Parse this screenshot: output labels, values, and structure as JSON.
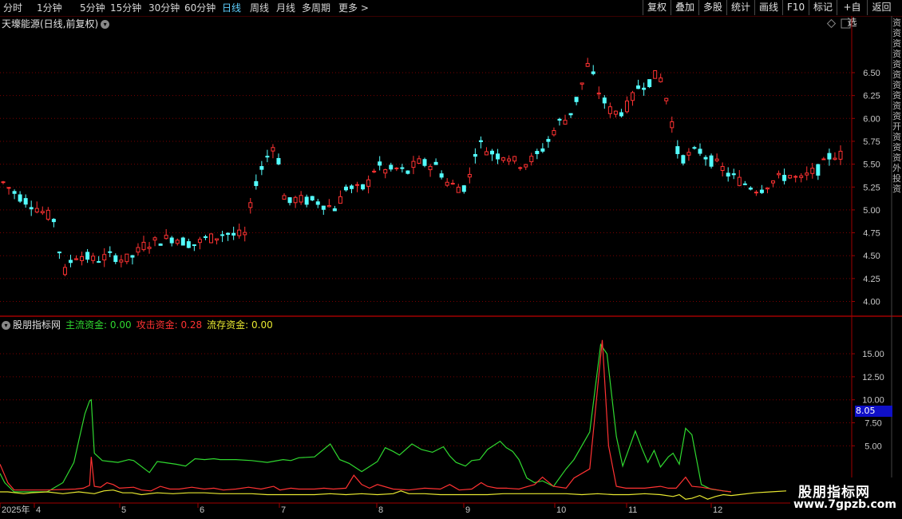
{
  "toolbar": {
    "periods": [
      "分时",
      "1分钟",
      "5分钟",
      "15分钟",
      "30分钟",
      "60分钟",
      "日线",
      "周线",
      "月线",
      "多周期",
      "更多"
    ],
    "active": "日线",
    "right": [
      "复权",
      "叠加",
      "多股",
      "统计",
      "画线",
      "F10",
      "标记",
      "+自选",
      "返回"
    ]
  },
  "main_title": "天壕能源(日线,前复权)",
  "indicator": {
    "name": "股朋指标网",
    "s1_label": "主流资金: 0.00",
    "s2_label": "攻击资金: 0.28",
    "s3_label": "流存资金: 0.00",
    "highlight_value": "8.05"
  },
  "x_labels": [
    "2025年",
    "4",
    "5",
    "6",
    "7",
    "8",
    "9",
    "10",
    "11",
    "12"
  ],
  "right_vertical_text": "资资资资资资资资资资开资资资外投资",
  "watermark": {
    "line1": "股朋指标网",
    "line2": "www.7gpzb.com"
  },
  "colors": {
    "up": "#ff3232",
    "down": "#54ffff",
    "green": "#2fd82f",
    "red": "#ff3232",
    "yellow": "#e8e830",
    "grid": "#7a0000",
    "axis": "#a00000"
  },
  "chart_data": [
    {
      "type": "candlestick",
      "title": "天壕能源(日线,前复权)",
      "y_ticks": [
        4.0,
        4.25,
        4.5,
        4.75,
        5.0,
        5.25,
        5.5,
        5.75,
        6.0,
        6.25,
        6.5
      ],
      "ylim": [
        3.9,
        6.8
      ],
      "close_path": [
        5.3,
        5.2,
        5.12,
        5.05,
        4.97,
        4.9,
        4.3,
        4.5,
        4.5,
        4.45,
        4.48,
        4.5,
        4.45,
        4.5,
        4.62,
        4.65,
        4.68,
        4.7,
        4.65,
        4.62,
        4.68,
        4.7,
        4.75,
        4.72,
        4.73,
        5.3,
        5.55,
        5.75,
        5.05,
        5.12,
        5.1,
        5.1,
        5.05,
        5.02,
        5.25,
        5.22,
        5.25,
        5.5,
        5.42,
        5.45,
        5.4,
        5.52,
        5.5,
        5.48,
        5.3,
        5.25,
        5.25,
        5.75,
        5.65,
        5.6,
        5.6,
        5.5,
        5.52,
        5.6,
        5.75,
        5.95,
        6.0,
        6.25,
        6.6,
        6.3,
        6.1,
        6.05,
        6.15,
        6.35,
        6.4,
        6.5,
        6.12,
        5.55,
        5.6,
        5.65,
        5.55,
        5.48,
        5.38,
        5.32,
        5.26,
        5.22,
        5.3,
        5.35,
        5.38,
        5.32,
        5.4,
        5.45,
        5.6,
        5.6
      ],
      "candles_drawn": 150
    },
    {
      "type": "line",
      "title": "股朋指标网",
      "y_ticks": [
        5.0,
        7.5,
        10.0,
        12.5,
        15.0
      ],
      "series": [
        {
          "name": "主流资金",
          "color": "green",
          "points": [
            [
              0,
              2
            ],
            [
              3,
              1
            ],
            [
              9,
              0
            ],
            [
              30,
              0
            ],
            [
              40,
              1
            ],
            [
              47,
              3.2
            ],
            [
              50,
              5.5
            ],
            [
              54,
              8.5
            ],
            [
              57,
              9.9
            ],
            [
              58,
              10
            ],
            [
              60,
              4.2
            ],
            [
              65,
              3.4
            ],
            [
              70,
              3.3
            ],
            [
              75,
              3.2
            ],
            [
              82,
              3.5
            ],
            [
              85,
              3.4
            ],
            [
              95,
              2.1
            ],
            [
              100,
              3.3
            ],
            [
              104,
              3.2
            ],
            [
              112,
              3
            ],
            [
              118,
              2.8
            ],
            [
              124,
              3.6
            ],
            [
              130,
              3.5
            ],
            [
              136,
              3.6
            ],
            [
              140,
              3.5
            ],
            [
              144,
              3.5
            ],
            [
              150,
              3.5
            ],
            [
              160,
              3.4
            ],
            [
              170,
              3.2
            ],
            [
              180,
              3.5
            ],
            [
              185,
              3.4
            ],
            [
              190,
              3.7
            ],
            [
              200,
              3.8
            ],
            [
              205,
              4.5
            ],
            [
              210,
              5.2
            ],
            [
              216,
              3.5
            ],
            [
              222,
              3.1
            ],
            [
              230,
              2.2
            ],
            [
              240,
              3.3
            ],
            [
              245,
              4.8
            ],
            [
              250,
              4.4
            ],
            [
              254,
              4
            ],
            [
              262,
              5.2
            ],
            [
              268,
              4.6
            ],
            [
              275,
              4.3
            ],
            [
              282,
              4.9
            ],
            [
              286,
              3.9
            ],
            [
              290,
              3.2
            ],
            [
              296,
              2.8
            ],
            [
              300,
              3.4
            ],
            [
              305,
              3.5
            ],
            [
              310,
              4.6
            ],
            [
              318,
              5.5
            ],
            [
              322,
              4.8
            ],
            [
              326,
              4.4
            ],
            [
              330,
              3.5
            ],
            [
              335,
              1.5
            ],
            [
              340,
              1
            ],
            [
              345,
              1.2
            ],
            [
              352,
              0.6
            ],
            [
              360,
              2.5
            ],
            [
              365,
              3.5
            ],
            [
              375,
              6.5
            ],
            [
              382,
              16
            ],
            [
              386,
              15
            ],
            [
              392,
              6
            ],
            [
              396,
              2.8
            ],
            [
              404,
              6.6
            ],
            [
              408,
              4.8
            ],
            [
              412,
              3.2
            ],
            [
              416,
              4.5
            ],
            [
              420,
              2.7
            ],
            [
              425,
              3.8
            ],
            [
              428,
              4.2
            ],
            [
              432,
              3
            ],
            [
              436,
              6.9
            ],
            [
              440,
              6.2
            ],
            [
              446,
              0.8
            ],
            [
              452,
              0.3
            ],
            [
              460,
              0.1
            ],
            [
              465,
              0
            ]
          ]
        },
        {
          "name": "攻击资金",
          "color": "red",
          "points": [
            [
              0,
              3
            ],
            [
              3,
              1.8
            ],
            [
              5,
              1
            ],
            [
              9,
              0.2
            ],
            [
              30,
              0.2
            ],
            [
              48,
              0.3
            ],
            [
              53,
              0.4
            ],
            [
              57,
              0.7
            ],
            [
              58,
              3.8
            ],
            [
              60,
              0.6
            ],
            [
              64,
              0.5
            ],
            [
              68,
              1
            ],
            [
              72,
              0.8
            ],
            [
              76,
              0.4
            ],
            [
              85,
              0.5
            ],
            [
              90,
              0.2
            ],
            [
              96,
              0.1
            ],
            [
              102,
              0.6
            ],
            [
              108,
              0.3
            ],
            [
              114,
              0.3
            ],
            [
              122,
              0.5
            ],
            [
              130,
              0.3
            ],
            [
              136,
              0.4
            ],
            [
              142,
              0.2
            ],
            [
              150,
              0.3
            ],
            [
              158,
              0.5
            ],
            [
              166,
              0.3
            ],
            [
              174,
              0.6
            ],
            [
              178,
              0.2
            ],
            [
              185,
              0.4
            ],
            [
              190,
              0.3
            ],
            [
              200,
              0.3
            ],
            [
              206,
              0.4
            ],
            [
              212,
              0.3
            ],
            [
              220,
              0.4
            ],
            [
              225,
              1.8
            ],
            [
              230,
              0.8
            ],
            [
              235,
              0.4
            ],
            [
              240,
              0.8
            ],
            [
              250,
              0.3
            ],
            [
              260,
              0.2
            ],
            [
              270,
              0.4
            ],
            [
              280,
              0.3
            ],
            [
              286,
              0.8
            ],
            [
              292,
              0.2
            ],
            [
              300,
              0.3
            ],
            [
              306,
              1
            ],
            [
              310,
              0.6
            ],
            [
              316,
              0.4
            ],
            [
              322,
              0.4
            ],
            [
              330,
              0.3
            ],
            [
              336,
              0.6
            ],
            [
              340,
              0.8
            ],
            [
              345,
              1.6
            ],
            [
              352,
              0.6
            ],
            [
              360,
              0.4
            ],
            [
              365,
              1.5
            ],
            [
              375,
              2.5
            ],
            [
              383,
              16.5
            ],
            [
              387,
              5
            ],
            [
              392,
              0.6
            ],
            [
              398,
              0.4
            ],
            [
              404,
              0.4
            ],
            [
              410,
              0.4
            ],
            [
              420,
              0.6
            ],
            [
              425,
              0.4
            ],
            [
              430,
              0.4
            ],
            [
              436,
              1.6
            ],
            [
              440,
              0.6
            ],
            [
              446,
              0.5
            ],
            [
              460,
              0.1
            ],
            [
              465,
              0
            ]
          ]
        },
        {
          "name": "流存资金",
          "color": "yellow",
          "points": [
            [
              0,
              0
            ],
            [
              5,
              0
            ],
            [
              10,
              -0.1
            ],
            [
              15,
              -0.2
            ],
            [
              20,
              -0.1
            ],
            [
              30,
              0
            ],
            [
              40,
              -0.2
            ],
            [
              50,
              0
            ],
            [
              60,
              -0.2
            ],
            [
              66,
              0.1
            ],
            [
              72,
              0.2
            ],
            [
              78,
              -0.1
            ],
            [
              84,
              -0.1
            ],
            [
              90,
              -0.3
            ],
            [
              100,
              -0.1
            ],
            [
              110,
              -0.2
            ],
            [
              120,
              -0.1
            ],
            [
              130,
              -0.1
            ],
            [
              140,
              -0.2
            ],
            [
              150,
              -0.2
            ],
            [
              160,
              -0.2
            ],
            [
              170,
              -0.3
            ],
            [
              180,
              -0.3
            ],
            [
              190,
              -0.3
            ],
            [
              200,
              -0.3
            ],
            [
              210,
              -0.2
            ],
            [
              220,
              -0.3
            ],
            [
              230,
              -0.2
            ],
            [
              240,
              -0.3
            ],
            [
              250,
              -0.2
            ],
            [
              255,
              0.1
            ],
            [
              260,
              -0.2
            ],
            [
              270,
              -0.2
            ],
            [
              280,
              -0.3
            ],
            [
              290,
              -0.3
            ],
            [
              300,
              -0.3
            ],
            [
              310,
              -0.3
            ],
            [
              320,
              -0.2
            ],
            [
              330,
              -0.2
            ],
            [
              340,
              -0.2
            ],
            [
              350,
              -0.2
            ],
            [
              360,
              -0.2
            ],
            [
              370,
              -0.3
            ],
            [
              380,
              -0.2
            ],
            [
              390,
              -0.3
            ],
            [
              400,
              -0.3
            ],
            [
              410,
              -0.2
            ],
            [
              420,
              -0.3
            ],
            [
              428,
              -0.5
            ],
            [
              432,
              -0.3
            ],
            [
              436,
              -0.8
            ],
            [
              440,
              -0.7
            ],
            [
              445,
              -0.4
            ],
            [
              450,
              -0.8
            ],
            [
              455,
              -0.5
            ],
            [
              460,
              -0.3
            ],
            [
              465,
              -0.4
            ],
            [
              470,
              -0.3
            ],
            [
              480,
              -0.1
            ],
            [
              490,
              0
            ],
            [
              500,
              0.1
            ]
          ]
        }
      ]
    }
  ]
}
